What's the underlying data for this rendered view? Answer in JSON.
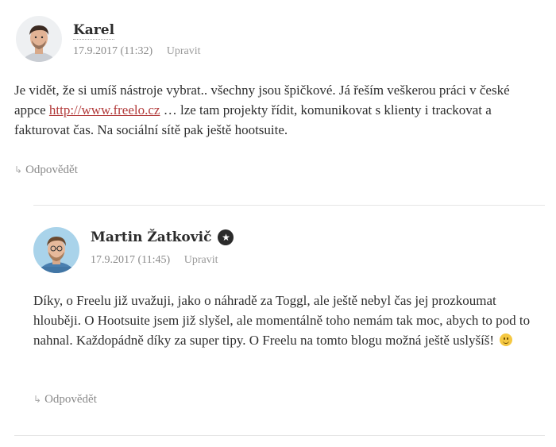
{
  "comments": [
    {
      "author": "Karel",
      "date": "17.9.2017 (11:32)",
      "edit_label": "Upravit",
      "text_before_link": "Je vidět, že si umíš nástroje vybrat.. všechny jsou špičkové. Já řeším veškerou práci v české appce ",
      "link_text": "http://www.freelo.cz",
      "text_after_link": " … lze tam projekty řídit, komunikovat s klienty i trackovat a fakturovat čas. Na sociální sítě pak ještě hootsuite.",
      "reply_label": "Odpovědět",
      "avatar_icon": "avatar-karel"
    },
    {
      "author": "Martin Žatkovič",
      "badge_icon": "star-icon",
      "badge_glyph": "★",
      "date": "17.9.2017 (11:45)",
      "edit_label": "Upravit",
      "text": "Díky, o Freelu již uvažuji, jako o náhradě za Toggl, ale ještě nebyl čas jej prozkoumat hlouběji. O Hootsuite jsem již slyšel, ale momentálně toho nemám tak moc, abych to pod to nahnal. Každopádně díky za super tipy. O Freelu na tomto blogu možná ještě uslyšíš!",
      "emoji_icon": "smile-emoji",
      "reply_label": "Odpovědět",
      "avatar_icon": "avatar-martin"
    }
  ],
  "reply_arrow_glyph": "↳",
  "colors": {
    "link": "#b23a3a",
    "meta": "#8a8a8a",
    "text": "#2e2e2e",
    "divider": "#e6e6e6"
  }
}
